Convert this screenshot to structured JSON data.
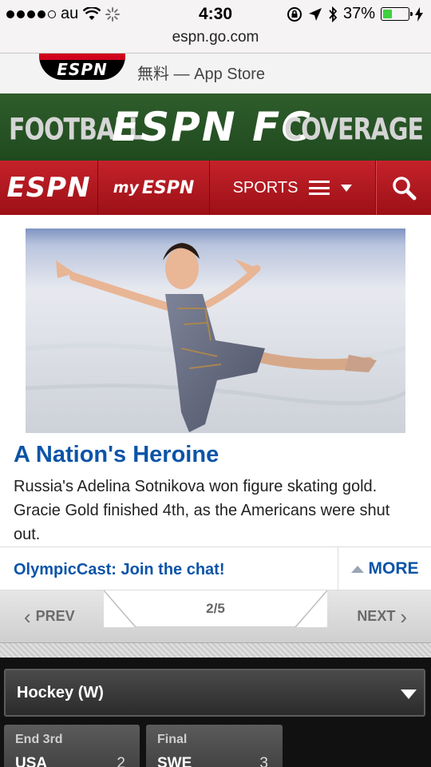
{
  "status": {
    "carrier": "au",
    "time": "4:30",
    "battery": "37%",
    "battery_fraction": 0.37
  },
  "browser": {
    "url": "espn.go.com"
  },
  "app_banner": {
    "icon_text": "ESPN",
    "label": "無料 — App Store"
  },
  "fc_banner": {
    "left": "FOOTBALL",
    "middle": "ESPN FC",
    "right": "COVERAGE"
  },
  "nav": {
    "logo": "ESPN",
    "my_prefix": "my",
    "my_logo": "ESPN",
    "sports": "SPORTS"
  },
  "article": {
    "headline": "A Nation's Heroine",
    "summary": "Russia's Adelina Sotnikova won figure skating gold. Gracie Gold finished 4th, as the Americans were shut out."
  },
  "links": {
    "chat": "OlympicCast: Join the chat!",
    "more": "MORE"
  },
  "pager": {
    "prev": "PREV",
    "count": "2/5",
    "next": "NEXT"
  },
  "scores": {
    "sport": "Hockey (W)",
    "games": [
      {
        "status": "End 3rd",
        "team": "USA",
        "score": "2"
      },
      {
        "status": "Final",
        "team": "SWE",
        "score": "3"
      }
    ]
  },
  "colors": {
    "espn_red": "#c5222b",
    "link_blue": "#0b54a8",
    "fc_green": "#2f5d2b"
  }
}
